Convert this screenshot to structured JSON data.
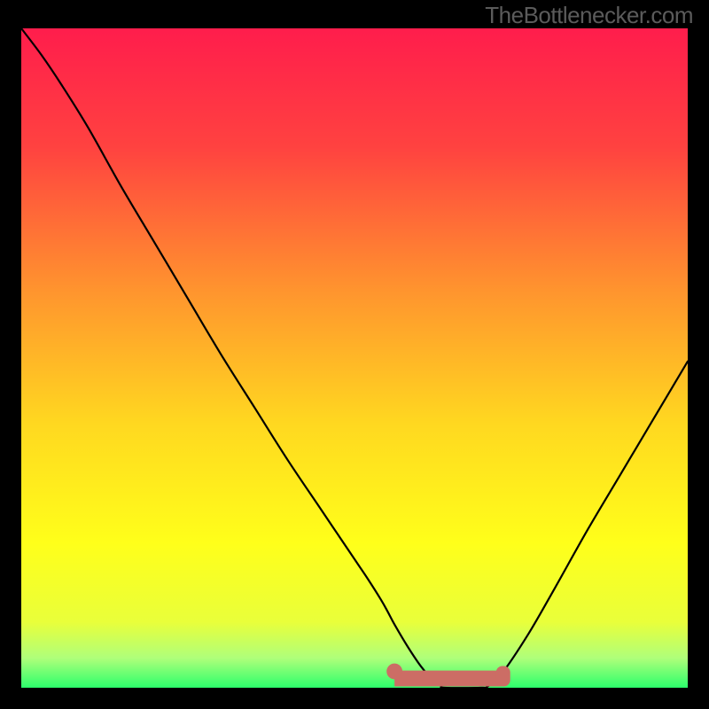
{
  "attribution": "TheBottlenecker.com",
  "chart_data": {
    "type": "line",
    "title": "",
    "xlabel": "",
    "ylabel": "",
    "xlim": [
      0,
      100
    ],
    "ylim": [
      0,
      100
    ],
    "gradient_stops": [
      {
        "offset": 0.0,
        "color": "#ff1d4c"
      },
      {
        "offset": 0.18,
        "color": "#ff4240"
      },
      {
        "offset": 0.4,
        "color": "#ff952e"
      },
      {
        "offset": 0.6,
        "color": "#ffd820"
      },
      {
        "offset": 0.78,
        "color": "#ffff1a"
      },
      {
        "offset": 0.9,
        "color": "#e9ff3a"
      },
      {
        "offset": 0.955,
        "color": "#afff7a"
      },
      {
        "offset": 1.0,
        "color": "#2cff6c"
      }
    ],
    "series": [
      {
        "name": "curve",
        "color": "#000000",
        "stroke_width": 2.2,
        "x": [
          0,
          3,
          6,
          10,
          15,
          20,
          25,
          30,
          35,
          40,
          45,
          50,
          52,
          54,
          55,
          56,
          58,
          60,
          62,
          63,
          63.5,
          69,
          70,
          72,
          76,
          80,
          85,
          90,
          95,
          100
        ],
        "y": [
          100,
          96,
          91.5,
          85,
          76,
          67.5,
          59,
          50.5,
          42.5,
          34.5,
          27,
          19.5,
          16.5,
          13.3,
          11.5,
          9.6,
          6.2,
          3.2,
          0.9,
          0.3,
          0,
          0,
          0.2,
          2,
          8,
          15,
          24,
          32.5,
          41,
          49.5
        ]
      }
    ],
    "flat_bar": {
      "name": "optimal-range",
      "color": "#cc6d65",
      "x_start": 56,
      "x_end": 72.3,
      "y": 1.4,
      "thickness_pct": 2.4,
      "dot_radius_pct": 1.2,
      "end_cap_height_pct": 3.1
    }
  }
}
